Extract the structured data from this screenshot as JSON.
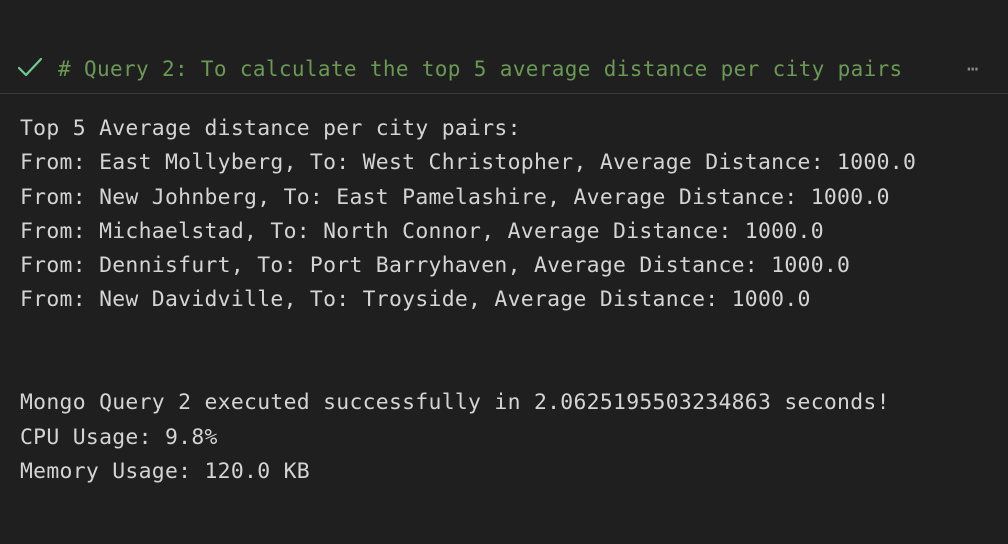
{
  "cell": {
    "status_icon": "check-icon",
    "title": "# Query 2: To calculate the top 5 average distance per city pairs",
    "more_icon": "ellipsis-icon",
    "more_label": "⋯"
  },
  "output": {
    "heading": "Top 5 Average distance per city pairs:",
    "rows": [
      "From: East Mollyberg, To: West Christopher, Average Distance: 1000.0",
      "From: New Johnberg, To: East Pamelashire, Average Distance: 1000.0",
      "From: Michaelstad, To: North Connor, Average Distance: 1000.0",
      "From: Dennisfurt, To: Port Barryhaven, Average Distance: 1000.0",
      "From: New Davidville, To: Troyside, Average Distance: 1000.0"
    ],
    "execution_message": "Mongo Query 2 executed successfully in 2.0625195503234863 seconds!",
    "cpu_usage": "CPU Usage: 9.8%",
    "memory_usage": "Memory Usage: 120.0 KB"
  },
  "colors": {
    "background": "#1f1f1f",
    "comment_green": "#6a9955",
    "check_green": "#73c991",
    "text": "#d4d4d4"
  }
}
